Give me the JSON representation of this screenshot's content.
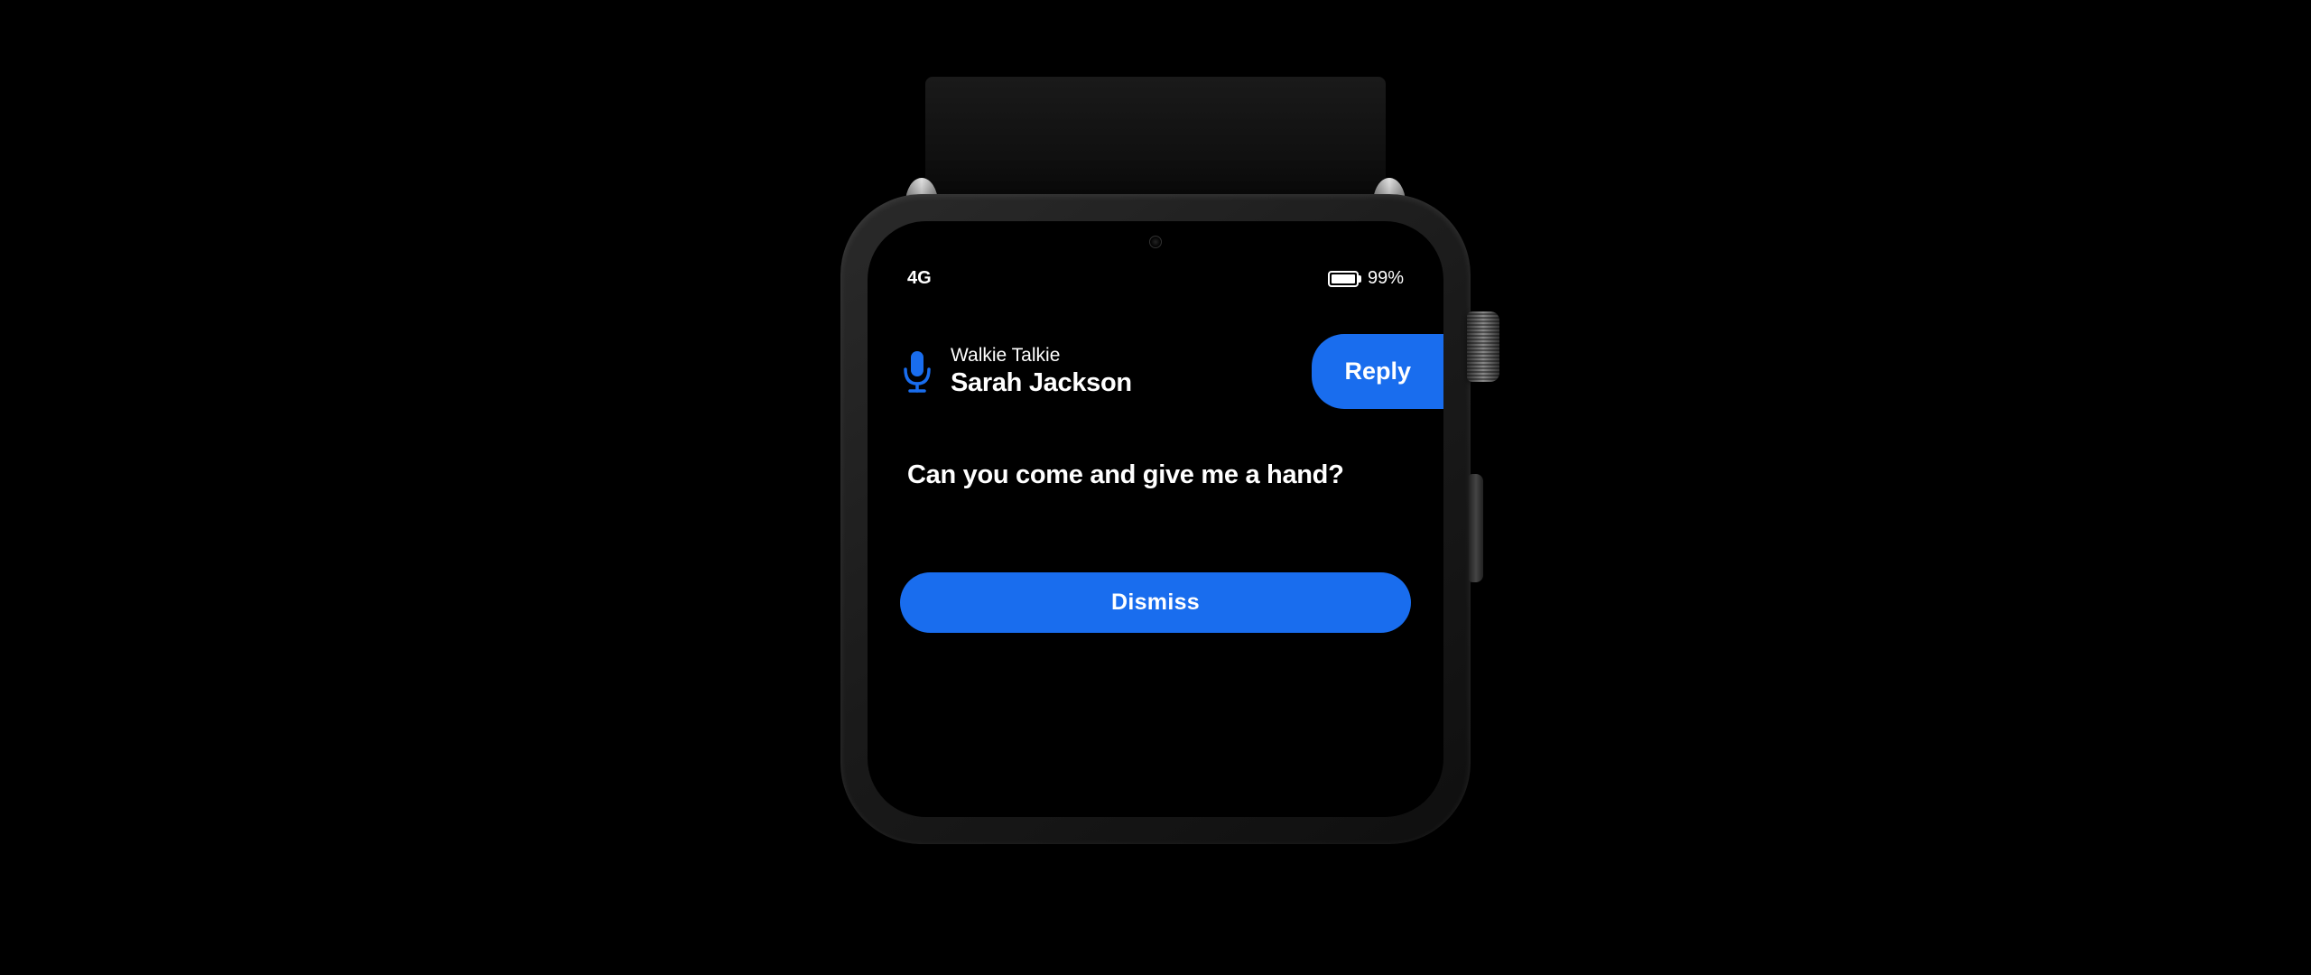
{
  "status": {
    "network": "4G",
    "battery_pct": "99%"
  },
  "notification": {
    "app_name": "Walkie Talkie",
    "sender": "Sarah Jackson",
    "message": "Can you come and give me a hand?",
    "reply_label": "Reply",
    "dismiss_label": "Dismiss"
  },
  "colors": {
    "accent": "#196dee"
  }
}
